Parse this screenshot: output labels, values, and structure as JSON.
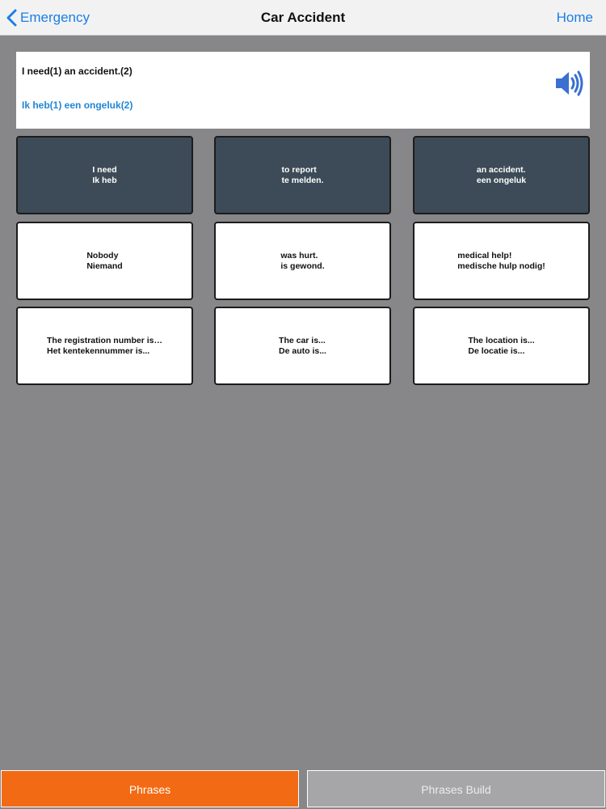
{
  "navbar": {
    "back_label": "Emergency",
    "title": "Car Accident",
    "home_label": "Home"
  },
  "phrase": {
    "english": "I need(1) an accident.(2)",
    "dutch": "Ik heb(1) een ongeluk(2)"
  },
  "colors": {
    "accent_blue": "#1a7ee8",
    "tile_dark": "#3c4b57",
    "tab_active": "#f26b14",
    "tab_inactive": "#a6a6a8",
    "background": "#878789"
  },
  "tiles": [
    {
      "en": "I need",
      "nl": "Ik heb",
      "selected": true
    },
    {
      "en": "to report",
      "nl": "te melden.",
      "selected": true
    },
    {
      "en": "an accident.",
      "nl": "een ongeluk",
      "selected": true
    },
    {
      "en": "Nobody",
      "nl": "Niemand",
      "selected": false
    },
    {
      "en": "was hurt.",
      "nl": "is gewond.",
      "selected": false
    },
    {
      "en": "medical help!",
      "nl": "medische hulp nodig!",
      "selected": false
    },
    {
      "en": "The registration number is…",
      "nl": "Het kentekennummer is...",
      "selected": false
    },
    {
      "en": "The car is...",
      "nl": "De auto is...",
      "selected": false
    },
    {
      "en": "The location is...",
      "nl": "De locatie is...",
      "selected": false
    }
  ],
  "tabs": {
    "phrases_label": "Phrases",
    "build_label": "Phrases Build",
    "active": "Phrases"
  }
}
